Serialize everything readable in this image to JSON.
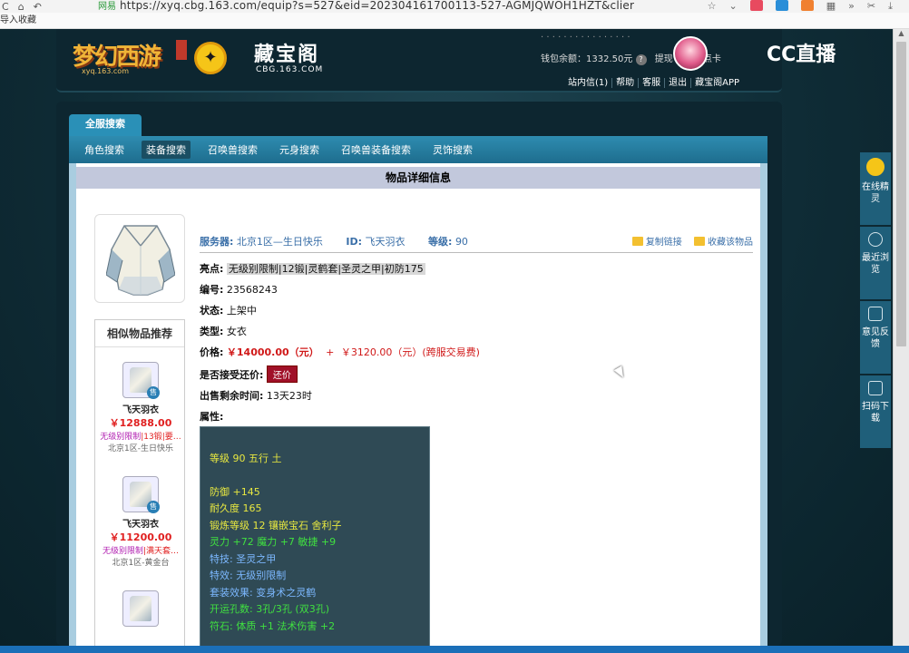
{
  "browser": {
    "nav_icons": [
      "back-icon",
      "home-icon",
      "refresh-icon"
    ],
    "secure_label": "网易",
    "url": "https://xyq.cbg.163.com/equip?s=527&eid=202304161700113-527-AGMJQWOH1HZT&clier",
    "bookmark_bar": "导入收藏"
  },
  "header": {
    "game_logo": "梦幻西游",
    "game_domain": "xyq.163.com",
    "cbg_name": "藏宝阁",
    "cbg_domain": "CBG.163.COM",
    "wallet_label": "钱包余额：",
    "wallet_value": "1332.50元",
    "withdraw": "提现",
    "buy_card": "购买点卡",
    "links": [
      "站内信(1)",
      "帮助",
      "客服",
      "退出",
      "藏宝阁APP"
    ],
    "cc_logo": "CC直播"
  },
  "float_panel": [
    {
      "label": "在线精灵"
    },
    {
      "label": "最近浏览"
    },
    {
      "label": "意见反馈"
    },
    {
      "label": "扫码下载"
    }
  ],
  "tabs": {
    "top": "全服搜索",
    "sub": [
      "角色搜索",
      "装备搜索",
      "召唤兽搜索",
      "元身搜索",
      "召唤兽装备搜索",
      "灵饰搜索"
    ],
    "active_index": 1
  },
  "detail": {
    "title": "物品详细信息",
    "server_label": "服务器:",
    "server_value": "北京1区—生日快乐",
    "id_label": "ID:",
    "id_value": "飞天羽衣",
    "level_label": "等级:",
    "level_value": "90",
    "copy_link": "复制链接",
    "collect": "收藏该物品",
    "highlights_label": "亮点:",
    "highlights_value": "无级别限制|12锻|灵鹤套|圣灵之甲|初防175",
    "number_label": "编号:",
    "number_value": "23568243",
    "status_label": "状态:",
    "status_value": "上架中",
    "type_label": "类型:",
    "type_value": "女衣",
    "price_label": "价格:",
    "price_value": "￥14000.00（元）",
    "price_plus": "+",
    "fee_value": "￥3120.00（元）(跨服交易费)",
    "bargain_label": "是否接受还价:",
    "bargain_button": "还价",
    "time_label": "出售剩余时间:",
    "time_value": "13天23时",
    "attr_label": "属性:"
  },
  "attributes": {
    "level_line": "等级 90  五行 土",
    "defense": "防御 +145",
    "durability": "耐久度 165",
    "forge": "锻炼等级 12  镶嵌宝石 舍利子",
    "stats": "灵力 +72  魔力 +7  敏捷 +9",
    "special_skill": "特技: 圣灵之甲",
    "special_effect": "特效: 无级别限制",
    "set_effect": "套装效果: 变身术之灵鹤",
    "holes": "开运孔数: 3孔/3孔 (双3孔)",
    "runes": "符石: 体质 +1  法术伤害 +2"
  },
  "similar": {
    "title": "相似物品推荐",
    "items": [
      {
        "name": "飞天羽衣",
        "price": "￥12888.00",
        "tag1": "无级别限制",
        "tag2": "|13锻|要…",
        "server": "北京1区-生日快乐"
      },
      {
        "name": "飞天羽衣",
        "price": "￥11200.00",
        "tag1": "无级别限制",
        "tag2": "|满天套…",
        "server": "北京1区-黄金台"
      },
      {
        "name": "",
        "price": "",
        "tag1": "",
        "tag2": "",
        "server": ""
      }
    ]
  },
  "colors": {
    "accent": "#2a90b7",
    "price_red": "#d01818",
    "attr_yellow": "#e8e840",
    "attr_green": "#40e040",
    "attr_blue": "#7cb8ff"
  }
}
